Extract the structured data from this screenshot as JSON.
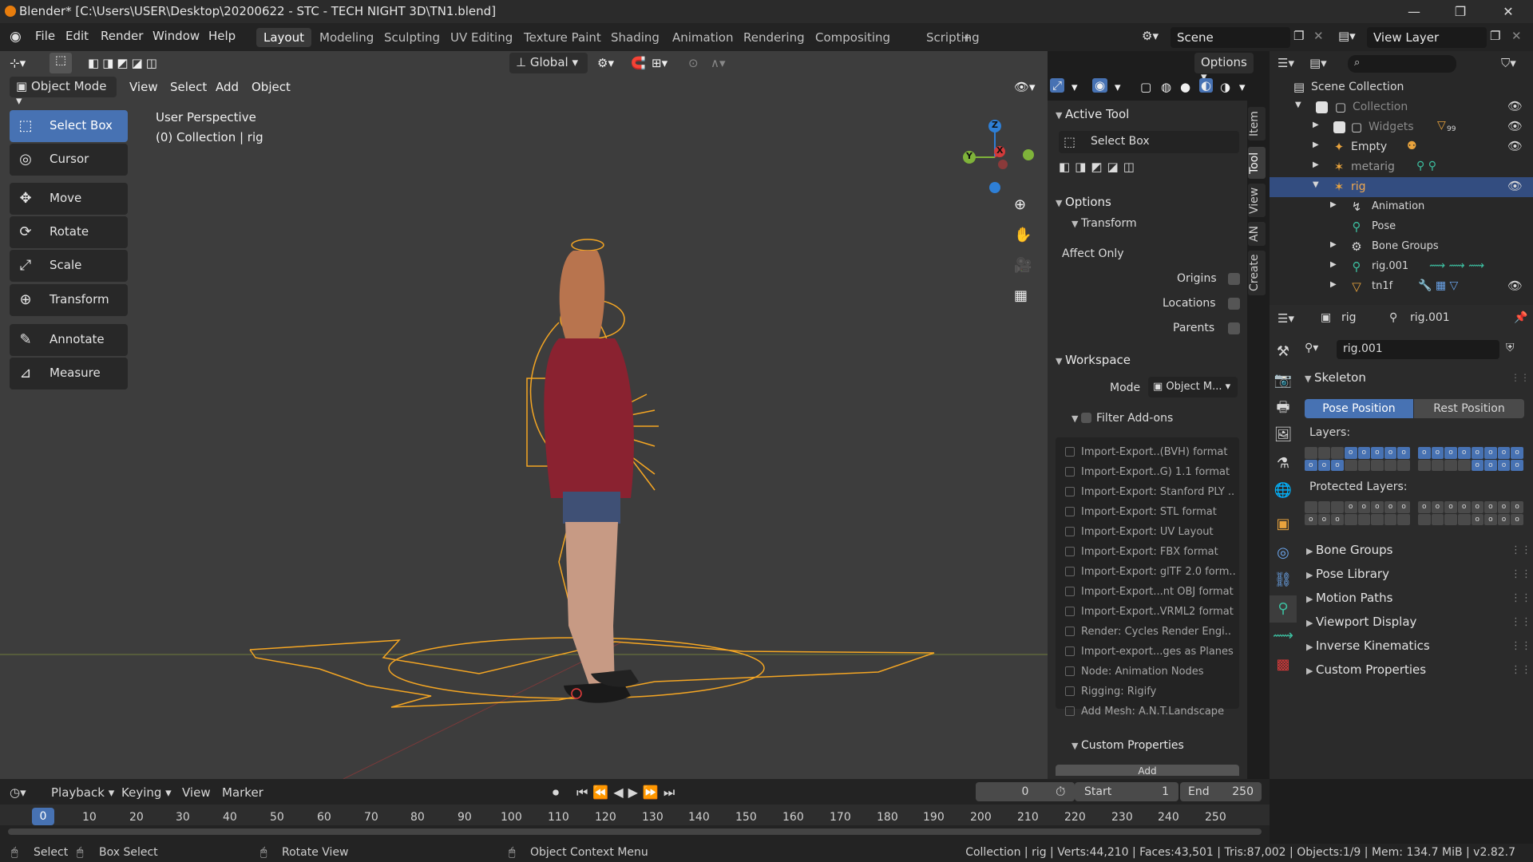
{
  "window": {
    "title": "Blender* [C:\\Users\\USER\\Desktop\\20200622 - STC - TECH NIGHT 3D\\TN1.blend]",
    "minimize": "—",
    "maximize": "❐",
    "close": "✕"
  },
  "menu": [
    "File",
    "Edit",
    "Render",
    "Window",
    "Help"
  ],
  "workspaces": [
    "Layout",
    "Modeling",
    "Sculpting",
    "UV Editing",
    "Texture Paint",
    "Shading",
    "Animation",
    "Rendering",
    "Compositing",
    "Scripting",
    "+"
  ],
  "active_workspace": "Layout",
  "scene": {
    "name": "Scene",
    "view_layer": "View Layer"
  },
  "viewport_header": {
    "transform_orientation": "Global",
    "options": "Options",
    "mode": "Object Mode",
    "view": "View",
    "select": "Select",
    "add": "Add",
    "object": "Object"
  },
  "viewport": {
    "perspective": "User Perspective",
    "collection_info": "(0) Collection | rig",
    "gizmo": {
      "x": "X",
      "y": "Y",
      "z": "Z"
    }
  },
  "toolbar": [
    {
      "label": "Select Box",
      "icon": "select-box-icon",
      "glyph": "⬚"
    },
    {
      "label": "Cursor",
      "icon": "cursor-icon",
      "glyph": "◎"
    },
    {
      "label": "Move",
      "icon": "move-icon",
      "glyph": "✥"
    },
    {
      "label": "Rotate",
      "icon": "rotate-icon",
      "glyph": "⟳"
    },
    {
      "label": "Scale",
      "icon": "scale-icon",
      "glyph": "⤢"
    },
    {
      "label": "Transform",
      "icon": "transform-icon",
      "glyph": "⊕"
    },
    {
      "label": "Annotate",
      "icon": "annotate-icon",
      "glyph": "✎"
    },
    {
      "label": "Measure",
      "icon": "measure-icon",
      "glyph": "📐"
    }
  ],
  "side_tabs": [
    "Item",
    "Tool",
    "View",
    "AN",
    "Create"
  ],
  "npanel": {
    "active_tool": "Active Tool",
    "active_tool_name": "Select Box",
    "options": "Options",
    "transform": "Transform",
    "affect_only": "Affect Only",
    "origins": "Origins",
    "locations": "Locations",
    "parents": "Parents",
    "workspace": "Workspace",
    "mode_label": "Mode",
    "mode_value": "Object M...",
    "filter_addons": "Filter Add-ons",
    "addons": [
      "Import-Export..(BVH) format",
      "Import-Export..G) 1.1 format",
      "Import-Export: Stanford PLY ..",
      "Import-Export: STL format",
      "Import-Export: UV Layout",
      "Import-Export: FBX format",
      "Import-Export: glTF 2.0 form..",
      "Import-Export...nt OBJ format",
      "Import-Export..VRML2 format",
      "Render: Cycles Render Engi..",
      "Import-export...ges as Planes",
      "Node: Animation Nodes",
      "Rigging: Rigify",
      "Add Mesh: A.N.T.Landscape"
    ],
    "custom_properties": "Custom Properties",
    "add": "Add"
  },
  "outliner": {
    "rows": [
      {
        "label": "Scene Collection",
        "icon": "scene-collection-icon",
        "glyph": "▤"
      },
      {
        "label": "Collection",
        "icon": "collection-icon",
        "glyph": "▢"
      },
      {
        "label": "Widgets",
        "icon": "collection-icon",
        "glyph": "▢",
        "badge": "99"
      },
      {
        "label": "Empty",
        "icon": "empty-icon",
        "glyph": "✦"
      },
      {
        "label": "metarig",
        "icon": "armature-icon",
        "glyph": "✶"
      },
      {
        "label": "rig",
        "icon": "armature-icon",
        "glyph": "✶"
      },
      {
        "label": "Animation",
        "icon": "animation-icon",
        "glyph": "↯"
      },
      {
        "label": "Pose",
        "icon": "pose-icon",
        "glyph": "⚲"
      },
      {
        "label": "Bone Groups",
        "icon": "bone-groups-icon",
        "glyph": "⚙"
      },
      {
        "label": "rig.001",
        "icon": "armature-data-icon",
        "glyph": "⚲"
      },
      {
        "label": "tn1f",
        "icon": "mesh-icon",
        "glyph": "▽"
      }
    ],
    "search_placeholder": ""
  },
  "properties": {
    "object": "rig",
    "data": "rig.001",
    "datablock": "rig.001",
    "skeleton": "Skeleton",
    "pose_position": "Pose Position",
    "rest_position": "Rest Position",
    "layers": "Layers:",
    "protected_layers": "Protected Layers:",
    "panels": [
      "Bone Groups",
      "Pose Library",
      "Motion Paths",
      "Viewport Display",
      "Inverse Kinematics",
      "Custom Properties"
    ]
  },
  "timeline": {
    "playback": "Playback",
    "keying": "Keying",
    "view": "View",
    "marker": "Marker",
    "current_frame": "0",
    "start_label": "Start",
    "start": "1",
    "end_label": "End",
    "end": "250",
    "ticks": [
      "0",
      "10",
      "20",
      "30",
      "40",
      "50",
      "60",
      "70",
      "80",
      "90",
      "100",
      "110",
      "120",
      "130",
      "140",
      "150",
      "160",
      "170",
      "180",
      "190",
      "200",
      "210",
      "220",
      "230",
      "240",
      "250"
    ]
  },
  "statusbar": {
    "select": "Select",
    "box_select": "Box Select",
    "rotate_view": "Rotate View",
    "context_menu": "Object Context Menu",
    "stats": "Collection | rig | Verts:44,210 | Faces:43,501 | Tris:87,002 | Objects:1/9 | Mem: 134.7 MiB | v2.82.7"
  },
  "colors": {
    "accent": "#4772b3",
    "rig_wire": "#f5a623",
    "viewport_bg": "#3d3d3d",
    "panel_bg": "#2b2b2b"
  }
}
